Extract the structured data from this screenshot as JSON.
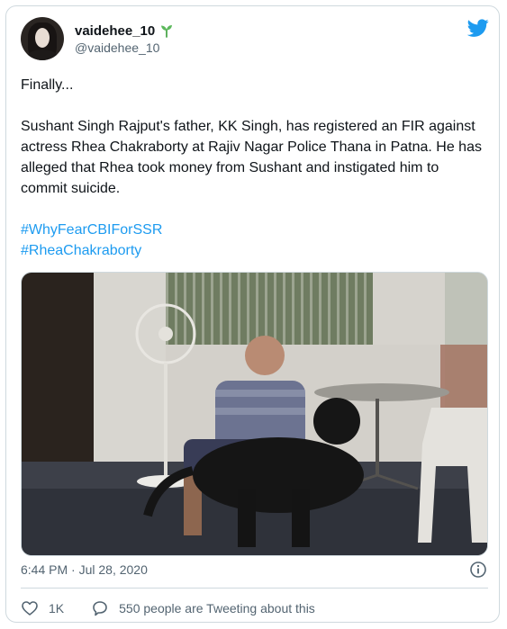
{
  "tweet": {
    "author": {
      "display_name": "vaidehee_10",
      "handle": "@vaidehee_10",
      "badge_icon": "sprout-icon"
    },
    "lines": {
      "intro": "Finally...",
      "body": "Sushant Singh Rajput's father, KK Singh, has registered an FIR against actress Rhea Chakraborty at Rajiv Nagar Police Thana in Patna. He has alleged that Rhea took money from Sushant and instigated him to commit suicide."
    },
    "hashtags": [
      "#WhyFearCBIForSSR",
      "#RheaChakraborty"
    ],
    "timestamp": "6:44 PM · Jul 28, 2020",
    "likes": "1K",
    "tweeting_about": "550 people are Tweeting about this"
  },
  "colors": {
    "accent": "#1d9bf0",
    "text_primary": "#0f1419",
    "text_secondary": "#536471",
    "border": "#cfd9de",
    "sprout": "#4ca84c"
  },
  "icons": [
    "twitter-bird-icon",
    "sprout-icon",
    "info-icon",
    "heart-icon",
    "speech-bubble-icon"
  ]
}
